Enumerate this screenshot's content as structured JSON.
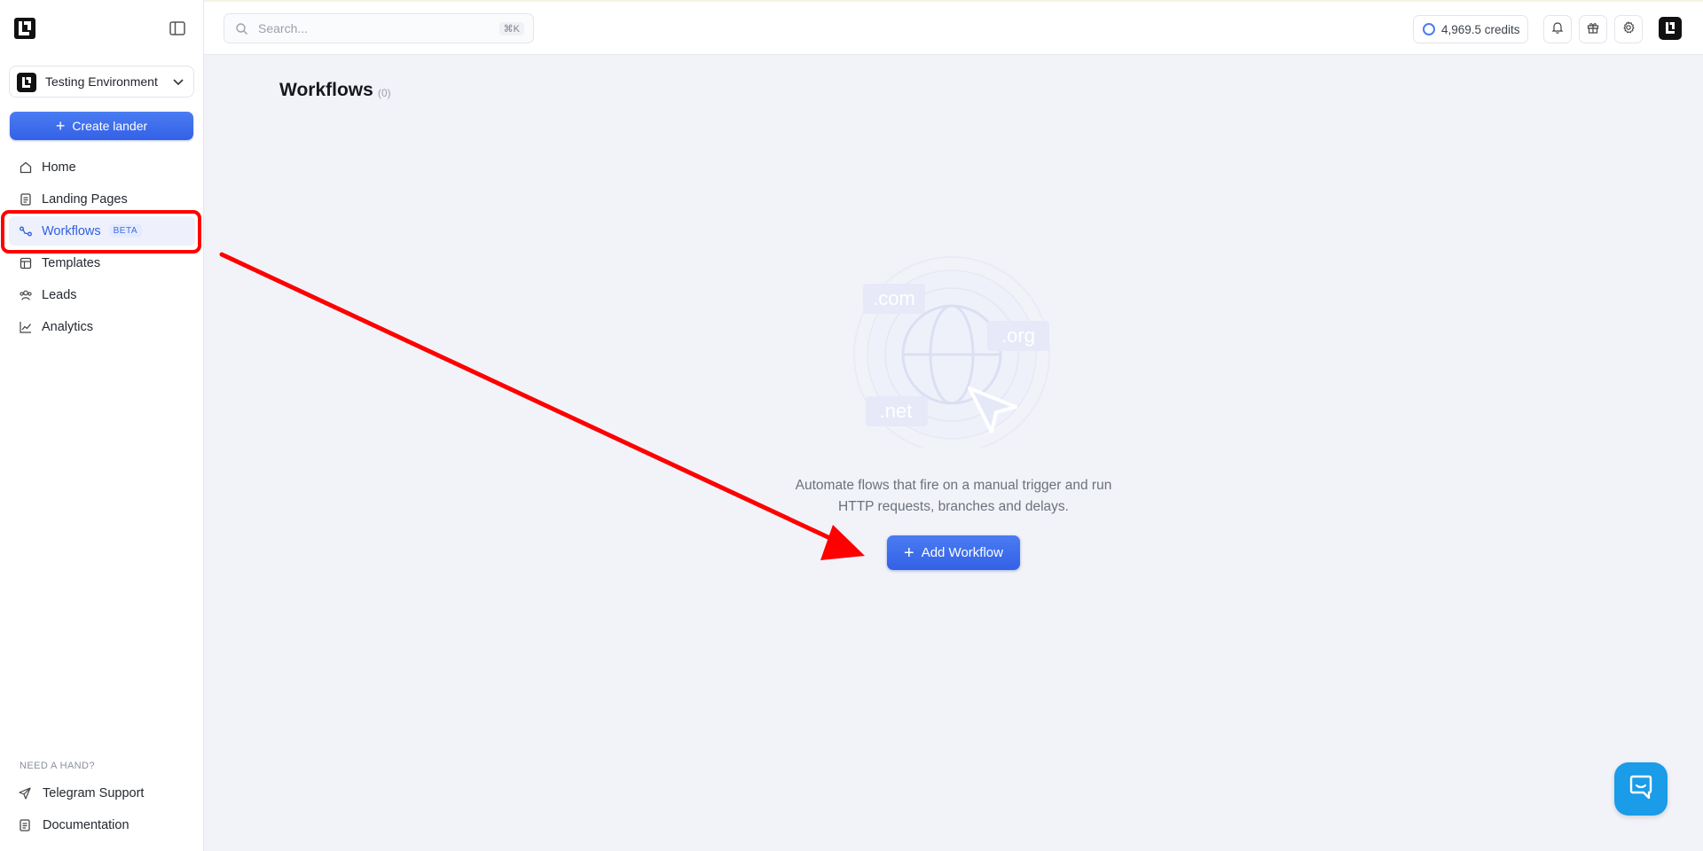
{
  "sidebar": {
    "environment": "Testing Environment",
    "create_label": "Create lander",
    "nav": [
      {
        "label": "Home",
        "icon": "home-icon"
      },
      {
        "label": "Landing Pages",
        "icon": "document-icon"
      },
      {
        "label": "Workflows",
        "icon": "workflow-icon",
        "badge": "BETA",
        "active": true
      },
      {
        "label": "Templates",
        "icon": "layout-icon"
      },
      {
        "label": "Leads",
        "icon": "users-icon"
      },
      {
        "label": "Analytics",
        "icon": "chart-icon"
      }
    ],
    "help_title": "NEED A HAND?",
    "help": [
      {
        "label": "Telegram Support",
        "icon": "send-icon"
      },
      {
        "label": "Documentation",
        "icon": "document-icon"
      }
    ]
  },
  "topbar": {
    "search_placeholder": "Search...",
    "search_shortcut": "⌘K",
    "credits": "4,969.5 credits"
  },
  "main": {
    "title": "Workflows",
    "count": "(0)",
    "illustration_labels": {
      "com": ".com",
      "org": ".org",
      "net": ".net"
    },
    "empty_text_line1": "Automate flows that fire on a manual trigger and run",
    "empty_text_line2": "HTTP requests, branches and delays.",
    "add_label": "Add Workflow"
  },
  "colors": {
    "accent": "#3a6be5",
    "annotation": "#ff0000",
    "chat": "#1a9ce8"
  }
}
